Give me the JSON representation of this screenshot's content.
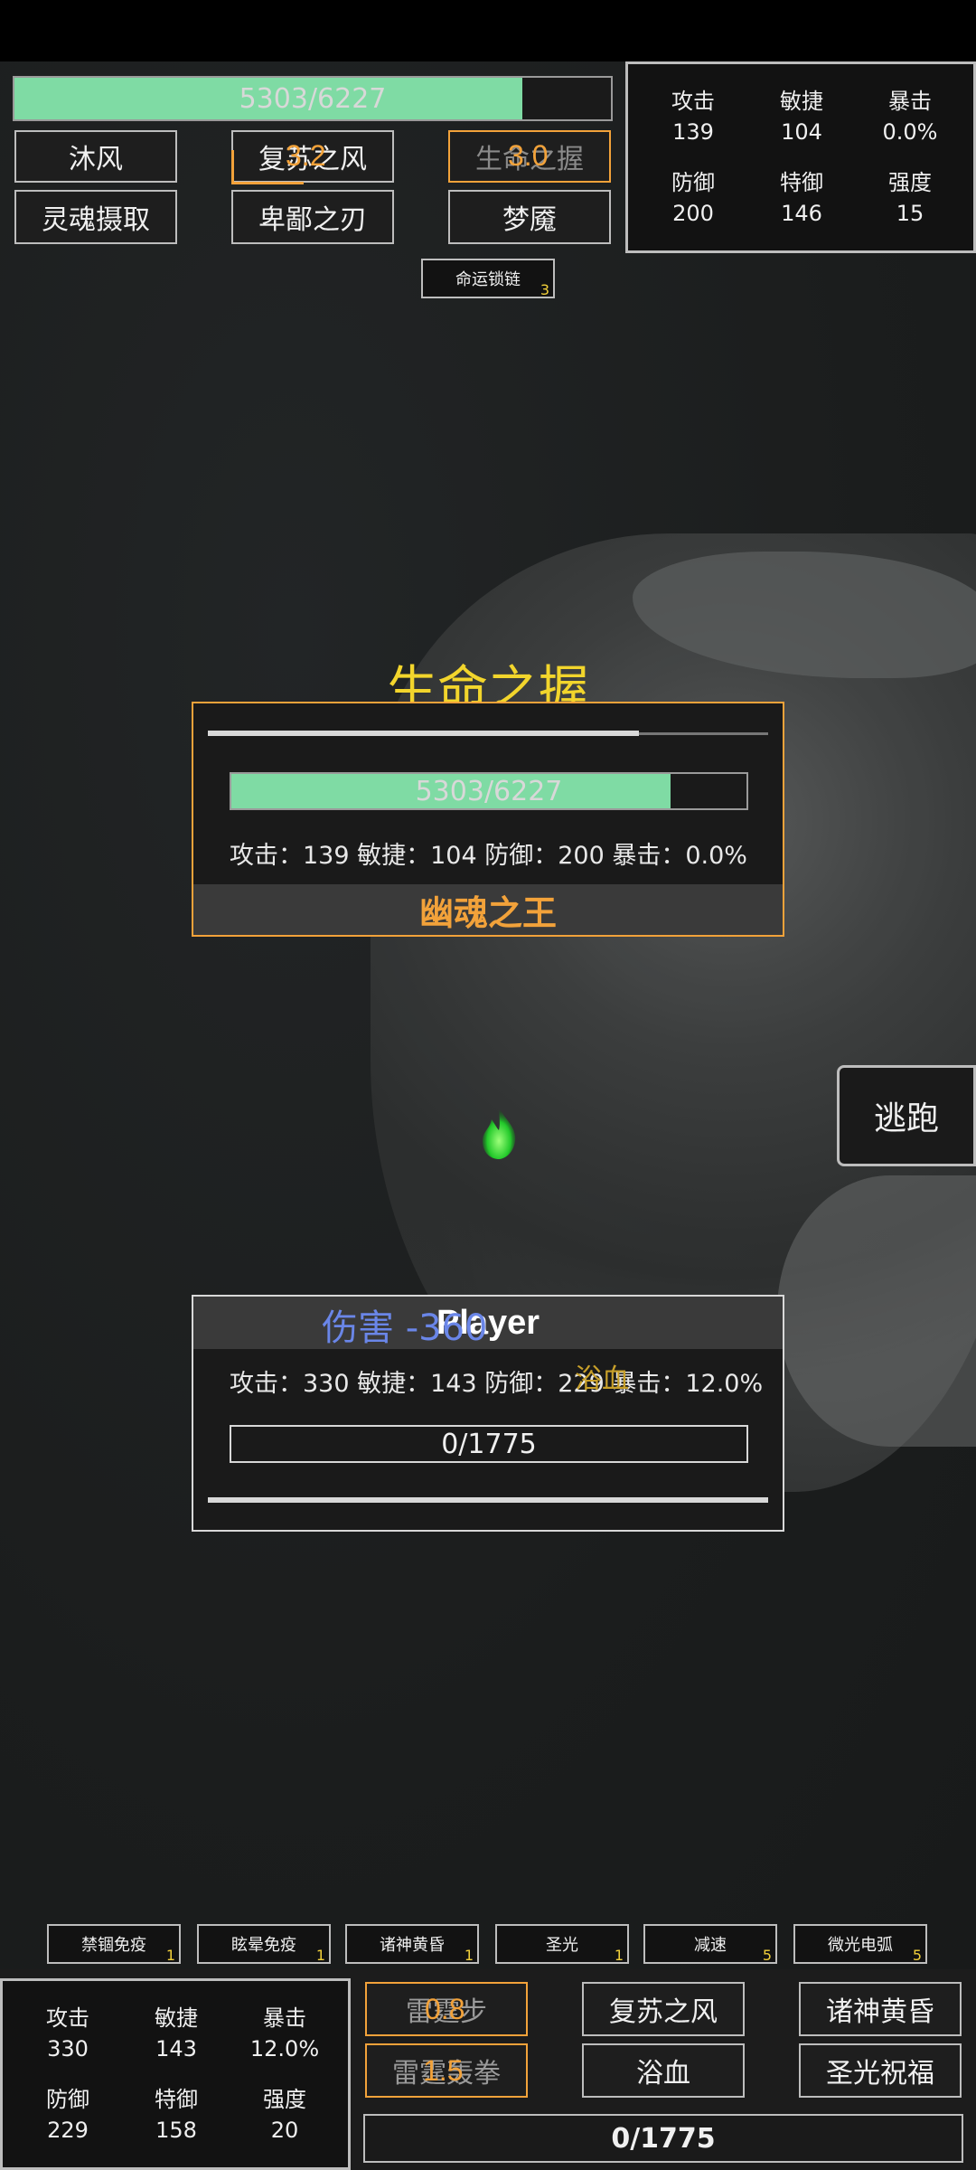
{
  "player_top": {
    "hp_text": "5303/6227",
    "hp_fraction": 0.852,
    "skills": [
      {
        "label": "沐风"
      },
      {
        "label": "复苏之风",
        "cooldown": "3.2"
      },
      {
        "label": "生命之握",
        "cooldown": "3.0"
      },
      {
        "label": "灵魂摄取"
      },
      {
        "label": "卑鄙之刃"
      },
      {
        "label": "梦魇"
      }
    ],
    "stats": [
      {
        "label": "攻击",
        "value": "139"
      },
      {
        "label": "敏捷",
        "value": "104"
      },
      {
        "label": "暴击",
        "value": "0.0%"
      },
      {
        "label": "防御",
        "value": "200"
      },
      {
        "label": "特御",
        "value": "146"
      },
      {
        "label": "强度",
        "value": "15"
      }
    ],
    "buff": {
      "label": "命运锁链",
      "count": "3"
    }
  },
  "enemy_panel": {
    "cast_title": "生命之握",
    "cast_progress": 0.77,
    "hp_text": "5303/6227",
    "hp_fraction": 0.852,
    "stat_line": "攻击：139   敏捷：104   防御：200   暴击：0.0%",
    "name": "幽魂之王"
  },
  "escape_button": "逃跑",
  "player_panel": {
    "damage_text": "伤害  -360",
    "name": "Player",
    "stat_line": "攻击：330   敏捷：143   防御：229   暴击：12.0%",
    "floating_text": "浴血",
    "mp_text": "0/1775",
    "mp_fraction": 0,
    "bar_progress": 1.0
  },
  "buffs_bottom": [
    {
      "label": "禁锢免疫",
      "count": "1"
    },
    {
      "label": "眩晕免疫",
      "count": "1"
    },
    {
      "label": "诸神黄昏",
      "count": "1"
    },
    {
      "label": "圣光",
      "count": "1"
    },
    {
      "label": "减速",
      "count": "5"
    },
    {
      "label": "微光电弧",
      "count": "5"
    }
  ],
  "player_bottom": {
    "stats": [
      {
        "label": "攻击",
        "value": "330"
      },
      {
        "label": "敏捷",
        "value": "143"
      },
      {
        "label": "暴击",
        "value": "12.0%"
      },
      {
        "label": "防御",
        "value": "229"
      },
      {
        "label": "特御",
        "value": "158"
      },
      {
        "label": "强度",
        "value": "20"
      }
    ],
    "skills": [
      {
        "label": "雷霆步",
        "cooldown": "0.8"
      },
      {
        "label": "复苏之风"
      },
      {
        "label": "诸神黄昏"
      },
      {
        "label": "雷霆轰拳",
        "cooldown": "1.5"
      },
      {
        "label": "浴血"
      },
      {
        "label": "圣光祝福"
      }
    ],
    "mp_text": "0/1775"
  },
  "colors": {
    "hp_green": "#7fdba4",
    "accent_orange": "#f2a23a",
    "title_yellow": "#f2d52c",
    "damage_blue": "#6a86e8"
  }
}
